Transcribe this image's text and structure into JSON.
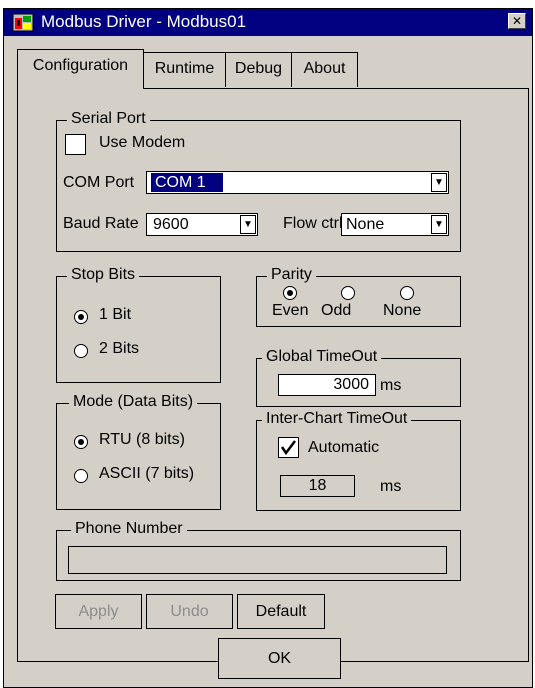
{
  "window": {
    "title": "Modbus Driver - Modbus01",
    "close_glyph": "✕"
  },
  "tabs": [
    {
      "label": "Configuration",
      "active": true
    },
    {
      "label": "Runtime"
    },
    {
      "label": "Debug"
    },
    {
      "label": "About"
    }
  ],
  "serial_port": {
    "legend": "Serial Port",
    "use_modem_label": "Use Modem",
    "use_modem_checked": false,
    "com_port_label": "COM Port",
    "com_port_value": "COM 1",
    "baud_rate_label": "Baud Rate",
    "baud_rate_value": "9600",
    "flow_ctrl_label": "Flow ctrl",
    "flow_ctrl_value": "None"
  },
  "stop_bits": {
    "legend": "Stop Bits",
    "options": [
      "1 Bit",
      "2 Bits"
    ],
    "selected": "1 Bit"
  },
  "parity": {
    "legend": "Parity",
    "options": [
      "Even",
      "Odd",
      "None"
    ],
    "selected": "Even"
  },
  "global_timeout": {
    "legend": "Global TimeOut",
    "value": "3000",
    "unit": "ms"
  },
  "mode": {
    "legend": "Mode (Data Bits)",
    "options": [
      "RTU (8 bits)",
      "ASCII (7 bits)"
    ],
    "selected": "RTU (8 bits)"
  },
  "inter_chart_timeout": {
    "legend": "Inter-Chart TimeOut",
    "automatic_label": "Automatic",
    "automatic_checked": true,
    "value": "18",
    "unit": "ms"
  },
  "phone_number": {
    "legend": "Phone Number",
    "value": ""
  },
  "buttons": {
    "apply": "Apply",
    "undo": "Undo",
    "default": "Default",
    "ok": "OK"
  },
  "colors": {
    "title_bar": "#000080",
    "dialog_bg": "#d4d0c8",
    "selection": "#000080"
  },
  "icons": {
    "app": "modbus-driver-icon",
    "dropdown": "dropdown-arrow-icon",
    "check": "checkmark-icon"
  }
}
